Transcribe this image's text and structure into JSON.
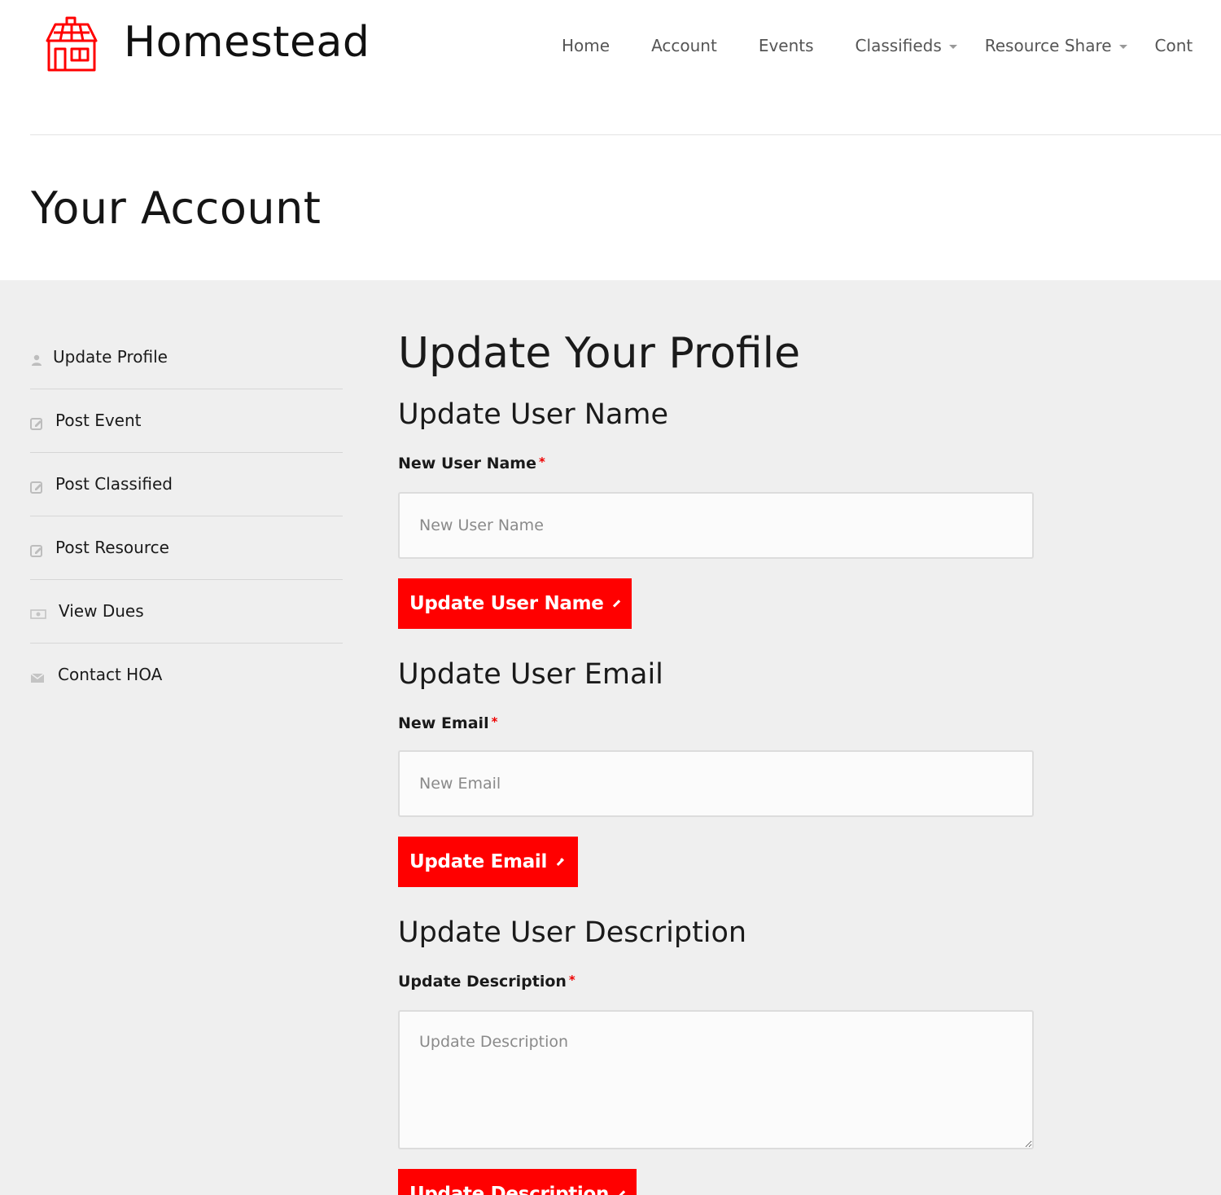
{
  "header": {
    "brand": "Homestead",
    "nav": [
      {
        "label": "Home",
        "dropdown": false
      },
      {
        "label": "Account",
        "dropdown": false
      },
      {
        "label": "Events",
        "dropdown": false
      },
      {
        "label": "Classifieds",
        "dropdown": true
      },
      {
        "label": "Resource Share",
        "dropdown": true
      },
      {
        "label": "Cont",
        "dropdown": false
      }
    ]
  },
  "page_title": "Your Account",
  "sidebar": {
    "items": [
      {
        "label": "Update Profile",
        "icon": "user-icon"
      },
      {
        "label": "Post Event",
        "icon": "edit-icon"
      },
      {
        "label": "Post Classified",
        "icon": "edit-icon"
      },
      {
        "label": "Post Resource",
        "icon": "edit-icon"
      },
      {
        "label": "View Dues",
        "icon": "money-icon"
      },
      {
        "label": "Contact HOA",
        "icon": "envelope-icon"
      }
    ]
  },
  "form": {
    "title": "Update Your Profile",
    "username": {
      "heading": "Update User Name",
      "label": "New User Name",
      "required_mark": "*",
      "placeholder": "New User Name",
      "value": "",
      "button": "Update User Name"
    },
    "email": {
      "heading": "Update User Email",
      "label": "New Email",
      "required_mark": "*",
      "placeholder": "New Email",
      "value": "",
      "button": "Update Email"
    },
    "description": {
      "heading": "Update User Description",
      "label": "Update Description",
      "required_mark": "*",
      "placeholder": "Update Description",
      "value": "",
      "button": "Update Description"
    }
  },
  "colors": {
    "accent": "#ff0000",
    "content_bg": "#efefef",
    "nav_text": "#555555"
  }
}
